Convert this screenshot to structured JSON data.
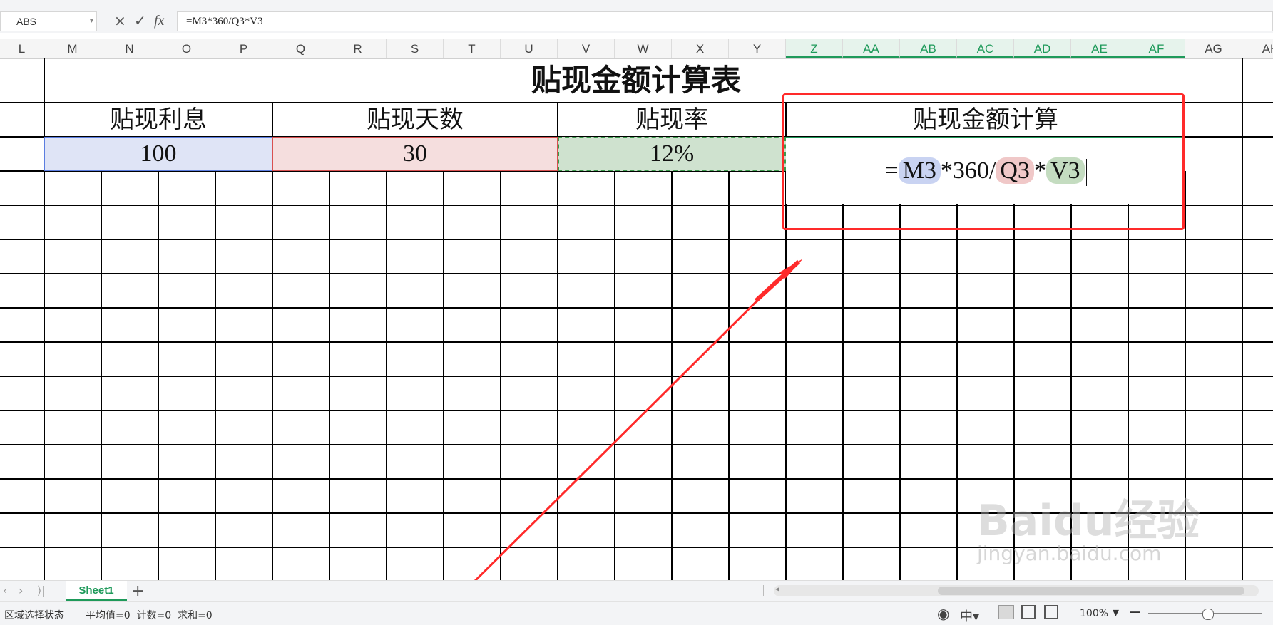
{
  "formula_bar": {
    "name_box": "ABS",
    "cancel_icon": "×",
    "confirm_icon": "✓",
    "fx_label": "fx",
    "formula": "=M3*360/Q3*V3"
  },
  "columns": [
    "L",
    "M",
    "N",
    "O",
    "P",
    "Q",
    "R",
    "S",
    "T",
    "U",
    "V",
    "W",
    "X",
    "Y",
    "Z",
    "AA",
    "AB",
    "AC",
    "AD",
    "AE",
    "AF",
    "AG",
    "AH"
  ],
  "selected_columns": [
    "Z",
    "AA",
    "AB",
    "AC",
    "AD",
    "AE",
    "AF"
  ],
  "sheet": {
    "title": "贴现金额计算表",
    "headers": [
      "贴现利息",
      "贴现天数",
      "贴现率",
      "贴现金额计算"
    ],
    "values": [
      "100",
      "30",
      "12%"
    ],
    "edit_formula": {
      "eq": "=",
      "ref1": "M3",
      "op1": "*360/",
      "ref2": "Q3",
      "op2": "*",
      "ref3": "V3"
    }
  },
  "colors": {
    "ref1_bg": "#c9d3f2",
    "ref2_bg": "#f0c8c8",
    "ref3_bg": "#c4dcc0",
    "highlight_box": "#ff2a2a",
    "accent": "#1e9a5a"
  },
  "sheet_tabs": {
    "active": "Sheet1",
    "add_icon": "+"
  },
  "status": {
    "mode": "区域选择状态",
    "stats": "平均值=0  计数=0  求和=0",
    "zoom": "100%"
  },
  "watermark": {
    "logo": "Baidu经验",
    "url": "jingyan.baidu.com"
  }
}
